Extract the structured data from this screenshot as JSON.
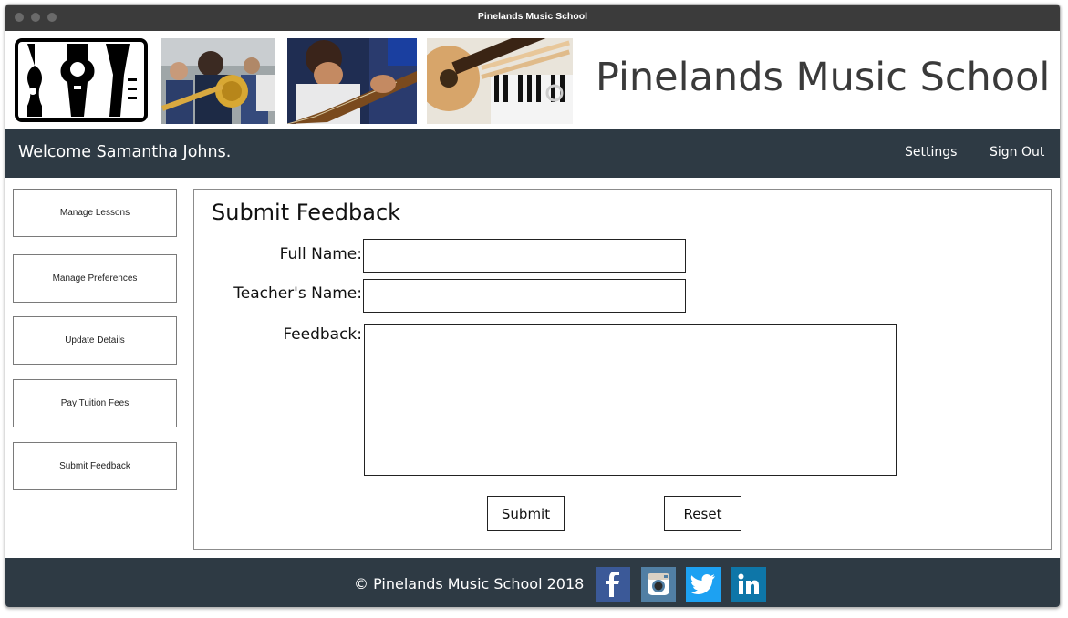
{
  "window": {
    "title": "Pinelands Music School"
  },
  "header": {
    "school_name": "Pinelands Music School",
    "logo_icon": "music-instruments-logo",
    "photos": [
      "trombone-students-photo",
      "guitar-student-photo",
      "ukulele-keyboard-photo"
    ]
  },
  "nav": {
    "welcome": "Welcome Samantha Johns.",
    "settings_label": "Settings",
    "signout_label": "Sign Out"
  },
  "sidebar": {
    "items": [
      {
        "label": "Manage Lessons"
      },
      {
        "label": "Manage Preferences"
      },
      {
        "label": "Update Details"
      },
      {
        "label": "Pay Tuition Fees"
      },
      {
        "label": "Submit Feedback"
      }
    ]
  },
  "form": {
    "title": "Submit Feedback",
    "full_name_label": "Full Name:",
    "full_name_value": "",
    "teacher_label": "Teacher's Name:",
    "teacher_value": "",
    "feedback_label": "Feedback:",
    "feedback_value": "",
    "submit_label": "Submit",
    "reset_label": "Reset"
  },
  "footer": {
    "copyright": "© Pinelands Music School  2018",
    "social": [
      {
        "icon": "facebook-icon",
        "color": "#3b5998"
      },
      {
        "icon": "instagram-icon",
        "color": "#517fa4"
      },
      {
        "icon": "twitter-icon",
        "color": "#1da1f2"
      },
      {
        "icon": "linkedin-icon",
        "color": "#0e76a8"
      }
    ]
  },
  "colors": {
    "navbar": "#2e3a44",
    "titlebar": "#3b3b3b"
  }
}
